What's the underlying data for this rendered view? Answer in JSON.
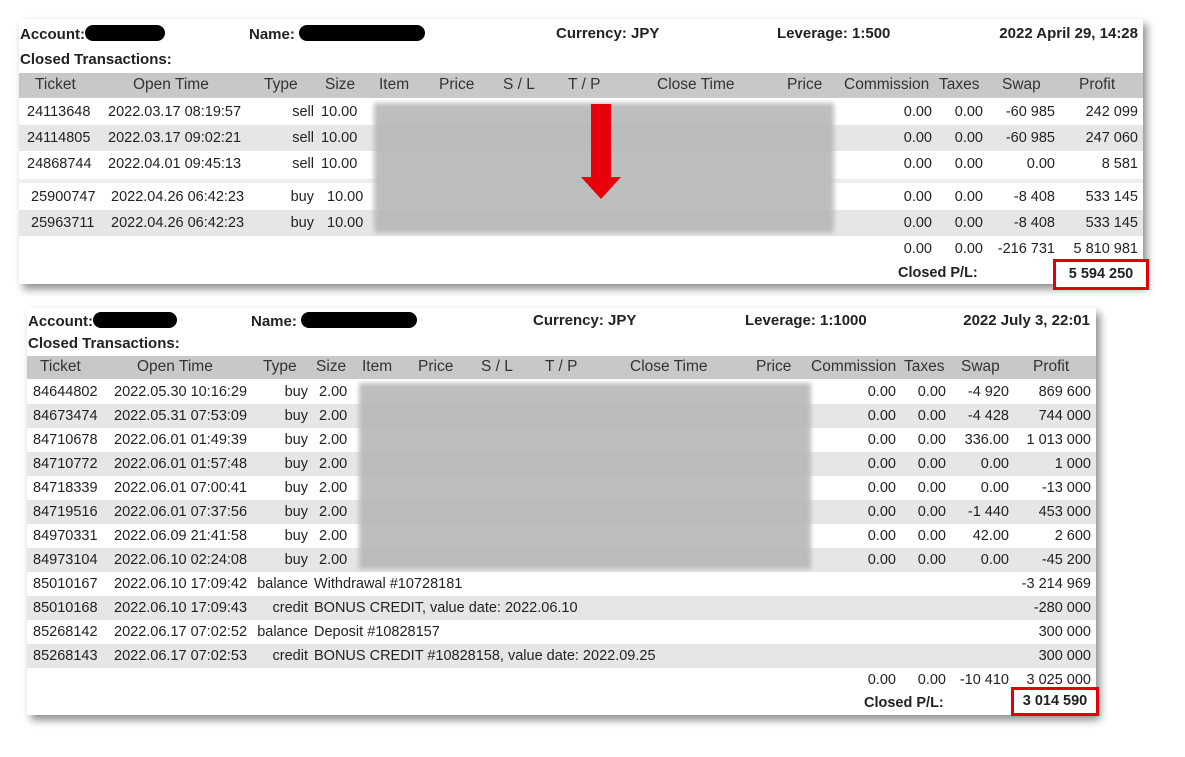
{
  "report1": {
    "header": {
      "account_label": "Account:",
      "name_label": "Name:",
      "currency": "Currency: JPY",
      "leverage": "Leverage: 1:500",
      "datetime": "2022 April 29, 14:28"
    },
    "section_title": "Closed Transactions:",
    "columns": [
      "Ticket",
      "Open Time",
      "Type",
      "Size",
      "Item",
      "Price",
      "S / L",
      "T / P",
      "Close Time",
      "Price",
      "Commission",
      "Taxes",
      "Swap",
      "Profit"
    ],
    "rows": [
      {
        "ticket": "24113648",
        "open_time": "2022.03.17 08:19:57",
        "type": "sell",
        "size": "10.00",
        "commission": "0.00",
        "taxes": "0.00",
        "swap": "-60 985",
        "profit": "242 099"
      },
      {
        "ticket": "24114805",
        "open_time": "2022.03.17 09:02:21",
        "type": "sell",
        "size": "10.00",
        "commission": "0.00",
        "taxes": "0.00",
        "swap": "-60 985",
        "profit": "247 060"
      },
      {
        "ticket": "24868744",
        "open_time": "2022.04.01 09:45:13",
        "type": "sell",
        "size": "10.00",
        "commission": "0.00",
        "taxes": "0.00",
        "swap": "0.00",
        "profit": "8 581"
      },
      {
        "ticket": "25900747",
        "open_time": "2022.04.26 06:42:23",
        "type": "buy",
        "size": "10.00",
        "commission": "0.00",
        "taxes": "0.00",
        "swap": "-8 408",
        "profit": "533 145"
      },
      {
        "ticket": "25963711",
        "open_time": "2022.04.26 06:42:23",
        "type": "buy",
        "size": "10.00",
        "commission": "0.00",
        "taxes": "0.00",
        "swap": "-8 408",
        "profit": "533 145"
      }
    ],
    "totals": {
      "commission": "0.00",
      "taxes": "0.00",
      "swap": "-216 731",
      "profit": "5 810 981"
    },
    "closed_pl_label": "Closed P/L:",
    "closed_pl_value": "5 594 250"
  },
  "report2": {
    "header": {
      "account_label": "Account:",
      "name_label": "Name:",
      "currency": "Currency: JPY",
      "leverage": "Leverage: 1:1000",
      "datetime": "2022 July 3, 22:01"
    },
    "section_title": "Closed Transactions:",
    "columns": [
      "Ticket",
      "Open Time",
      "Type",
      "Size",
      "Item",
      "Price",
      "S / L",
      "T / P",
      "Close Time",
      "Price",
      "Commission",
      "Taxes",
      "Swap",
      "Profit"
    ],
    "rows": [
      {
        "ticket": "84644802",
        "open_time": "2022.05.30 10:16:29",
        "type": "buy",
        "size": "2.00",
        "commission": "0.00",
        "taxes": "0.00",
        "swap": "-4 920",
        "profit": "869 600"
      },
      {
        "ticket": "84673474",
        "open_time": "2022.05.31 07:53:09",
        "type": "buy",
        "size": "2.00",
        "commission": "0.00",
        "taxes": "0.00",
        "swap": "-4 428",
        "profit": "744 000"
      },
      {
        "ticket": "84710678",
        "open_time": "2022.06.01 01:49:39",
        "type": "buy",
        "size": "2.00",
        "commission": "0.00",
        "taxes": "0.00",
        "swap": "336.00",
        "profit": "1 013 000"
      },
      {
        "ticket": "84710772",
        "open_time": "2022.06.01 01:57:48",
        "type": "buy",
        "size": "2.00",
        "commission": "0.00",
        "taxes": "0.00",
        "swap": "0.00",
        "profit": "1 000"
      },
      {
        "ticket": "84718339",
        "open_time": "2022.06.01 07:00:41",
        "type": "buy",
        "size": "2.00",
        "commission": "0.00",
        "taxes": "0.00",
        "swap": "0.00",
        "profit": "-13 000"
      },
      {
        "ticket": "84719516",
        "open_time": "2022.06.01 07:37:56",
        "type": "buy",
        "size": "2.00",
        "commission": "0.00",
        "taxes": "0.00",
        "swap": "-1 440",
        "profit": "453 000"
      },
      {
        "ticket": "84970331",
        "open_time": "2022.06.09 21:41:58",
        "type": "buy",
        "size": "2.00",
        "commission": "0.00",
        "taxes": "0.00",
        "swap": "42.00",
        "profit": "2 600"
      },
      {
        "ticket": "84973104",
        "open_time": "2022.06.10 02:24:08",
        "type": "buy",
        "size": "2.00",
        "commission": "0.00",
        "taxes": "0.00",
        "swap": "0.00",
        "profit": "-45 200"
      }
    ],
    "balance_rows": [
      {
        "ticket": "85010167",
        "open_time": "2022.06.10 17:09:42",
        "type": "balance",
        "description": "Withdrawal #10728181",
        "profit": "-3 214 969"
      },
      {
        "ticket": "85010168",
        "open_time": "2022.06.10 17:09:43",
        "type": "credit",
        "description": "BONUS CREDIT, value date: 2022.06.10",
        "profit": "-280 000"
      },
      {
        "ticket": "85268142",
        "open_time": "2022.06.17 07:02:52",
        "type": "balance",
        "description": "Deposit #10828157",
        "profit": "300 000"
      },
      {
        "ticket": "85268143",
        "open_time": "2022.06.17 07:02:53",
        "type": "credit",
        "description": "BONUS CREDIT #10828158, value date: 2022.09.25",
        "profit": "300 000"
      }
    ],
    "totals": {
      "commission": "0.00",
      "taxes": "0.00",
      "swap": "-10 410",
      "profit": "3 025 000"
    },
    "closed_pl_label": "Closed P/L:",
    "closed_pl_value": "3 014 590"
  },
  "colors": {
    "highlight_red": "#e0000b",
    "header_gray": "#c8c8c8",
    "stripe_gray": "#e6e6e6"
  },
  "icons": {
    "arrow": "down-arrow-icon",
    "redaction": "redaction-bar"
  }
}
